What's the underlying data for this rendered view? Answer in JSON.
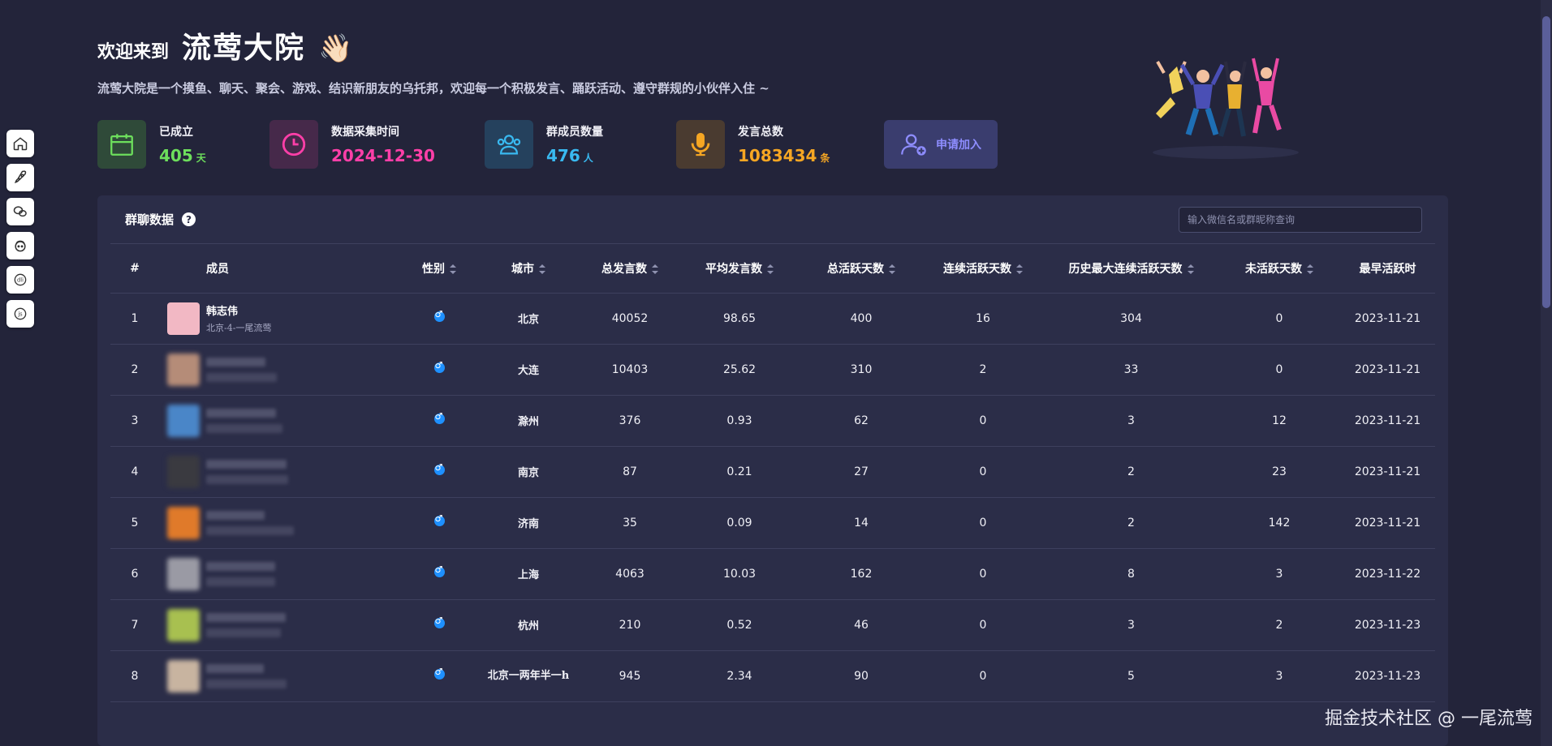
{
  "header": {
    "welcome_prefix": "欢迎来到",
    "group_name": "流莺大院",
    "wave_emoji": "👋🏻",
    "intro": "流莺大院是一个摸鱼、聊天、聚会、游戏、结识新朋友的乌托邦，欢迎每一个积极发言、踊跃活动、遵守群规的小伙伴入住 ~"
  },
  "stats": [
    {
      "label": "已成立",
      "value": "405",
      "unit": "天",
      "color": "#6ddf5c",
      "bg": "#2f4a39",
      "icon": "calendar-icon"
    },
    {
      "label": "数据采集时间",
      "value": "2024-12-30",
      "unit": "",
      "color": "#ff3fa8",
      "bg": "#46294a",
      "icon": "clock-icon"
    },
    {
      "label": "群成员数量",
      "value": "476",
      "unit": "人",
      "color": "#39b9f0",
      "bg": "#25415d",
      "icon": "users-icon"
    },
    {
      "label": "发言总数",
      "value": "1083434",
      "unit": "条",
      "color": "#f5a623",
      "bg": "#4a3b30",
      "icon": "mic-icon"
    }
  ],
  "join_label": "申请加入",
  "panel": {
    "title": "群聊数据",
    "search_placeholder": "输入微信名或群昵称查询"
  },
  "columns": [
    "#",
    "成员",
    "性别",
    "城市",
    "总发言数",
    "平均发言数",
    "总活跃天数",
    "连续活跃天数",
    "历史最大连续活跃天数",
    "未活跃天数",
    "最早活跃时"
  ],
  "rows": [
    {
      "rank": "1",
      "name": "韩志伟",
      "sub": "北京-4-一尾流莺",
      "city": "北京",
      "total": "40052",
      "avg": "98.65",
      "active": "400",
      "streak": "16",
      "max_streak": "304",
      "inactive": "0",
      "first": "2023-11-21"
    },
    {
      "rank": "2",
      "name": "",
      "sub": "",
      "city": "大连",
      "total": "10403",
      "avg": "25.62",
      "active": "310",
      "streak": "2",
      "max_streak": "33",
      "inactive": "0",
      "first": "2023-11-21"
    },
    {
      "rank": "3",
      "name": "",
      "sub": "",
      "city": "滁州",
      "total": "376",
      "avg": "0.93",
      "active": "62",
      "streak": "0",
      "max_streak": "3",
      "inactive": "12",
      "first": "2023-11-21"
    },
    {
      "rank": "4",
      "name": "",
      "sub": "",
      "city": "南京",
      "total": "87",
      "avg": "0.21",
      "active": "27",
      "streak": "0",
      "max_streak": "2",
      "inactive": "23",
      "first": "2023-11-21"
    },
    {
      "rank": "5",
      "name": "",
      "sub": "",
      "city": "济南",
      "total": "35",
      "avg": "0.09",
      "active": "14",
      "streak": "0",
      "max_streak": "2",
      "inactive": "142",
      "first": "2023-11-21"
    },
    {
      "rank": "6",
      "name": "",
      "sub": "",
      "city": "上海",
      "total": "4063",
      "avg": "10.03",
      "active": "162",
      "streak": "0",
      "max_streak": "8",
      "inactive": "3",
      "first": "2023-11-22"
    },
    {
      "rank": "7",
      "name": "",
      "sub": "",
      "city": "杭州",
      "total": "210",
      "avg": "0.52",
      "active": "46",
      "streak": "0",
      "max_streak": "3",
      "inactive": "2",
      "first": "2023-11-23"
    },
    {
      "rank": "8",
      "name": "",
      "sub": "",
      "city": "北京一两年半一h",
      "total": "945",
      "avg": "2.34",
      "active": "90",
      "streak": "0",
      "max_streak": "5",
      "inactive": "3",
      "first": "2023-11-23"
    }
  ],
  "watermark": "掘金技术社区 @ 一尾流莺",
  "side_nav": [
    "home-icon",
    "rocket-icon",
    "wechat-icon",
    "avatar-icon",
    "dli-icon",
    "js-icon"
  ]
}
